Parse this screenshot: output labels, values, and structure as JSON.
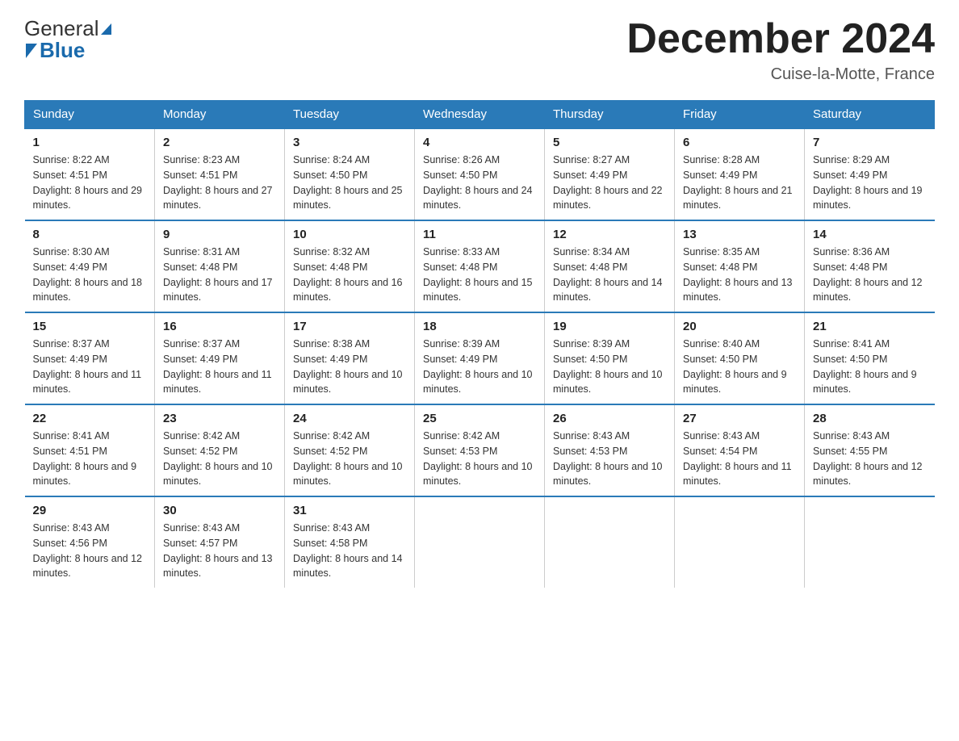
{
  "header": {
    "logo_general": "General",
    "logo_blue": "Blue",
    "month_title": "December 2024",
    "location": "Cuise-la-Motte, France"
  },
  "days_of_week": [
    "Sunday",
    "Monday",
    "Tuesday",
    "Wednesday",
    "Thursday",
    "Friday",
    "Saturday"
  ],
  "weeks": [
    [
      {
        "day": "1",
        "sunrise": "8:22 AM",
        "sunset": "4:51 PM",
        "daylight": "8 hours and 29 minutes."
      },
      {
        "day": "2",
        "sunrise": "8:23 AM",
        "sunset": "4:51 PM",
        "daylight": "8 hours and 27 minutes."
      },
      {
        "day": "3",
        "sunrise": "8:24 AM",
        "sunset": "4:50 PM",
        "daylight": "8 hours and 25 minutes."
      },
      {
        "day": "4",
        "sunrise": "8:26 AM",
        "sunset": "4:50 PM",
        "daylight": "8 hours and 24 minutes."
      },
      {
        "day": "5",
        "sunrise": "8:27 AM",
        "sunset": "4:49 PM",
        "daylight": "8 hours and 22 minutes."
      },
      {
        "day": "6",
        "sunrise": "8:28 AM",
        "sunset": "4:49 PM",
        "daylight": "8 hours and 21 minutes."
      },
      {
        "day": "7",
        "sunrise": "8:29 AM",
        "sunset": "4:49 PM",
        "daylight": "8 hours and 19 minutes."
      }
    ],
    [
      {
        "day": "8",
        "sunrise": "8:30 AM",
        "sunset": "4:49 PM",
        "daylight": "8 hours and 18 minutes."
      },
      {
        "day": "9",
        "sunrise": "8:31 AM",
        "sunset": "4:48 PM",
        "daylight": "8 hours and 17 minutes."
      },
      {
        "day": "10",
        "sunrise": "8:32 AM",
        "sunset": "4:48 PM",
        "daylight": "8 hours and 16 minutes."
      },
      {
        "day": "11",
        "sunrise": "8:33 AM",
        "sunset": "4:48 PM",
        "daylight": "8 hours and 15 minutes."
      },
      {
        "day": "12",
        "sunrise": "8:34 AM",
        "sunset": "4:48 PM",
        "daylight": "8 hours and 14 minutes."
      },
      {
        "day": "13",
        "sunrise": "8:35 AM",
        "sunset": "4:48 PM",
        "daylight": "8 hours and 13 minutes."
      },
      {
        "day": "14",
        "sunrise": "8:36 AM",
        "sunset": "4:48 PM",
        "daylight": "8 hours and 12 minutes."
      }
    ],
    [
      {
        "day": "15",
        "sunrise": "8:37 AM",
        "sunset": "4:49 PM",
        "daylight": "8 hours and 11 minutes."
      },
      {
        "day": "16",
        "sunrise": "8:37 AM",
        "sunset": "4:49 PM",
        "daylight": "8 hours and 11 minutes."
      },
      {
        "day": "17",
        "sunrise": "8:38 AM",
        "sunset": "4:49 PM",
        "daylight": "8 hours and 10 minutes."
      },
      {
        "day": "18",
        "sunrise": "8:39 AM",
        "sunset": "4:49 PM",
        "daylight": "8 hours and 10 minutes."
      },
      {
        "day": "19",
        "sunrise": "8:39 AM",
        "sunset": "4:50 PM",
        "daylight": "8 hours and 10 minutes."
      },
      {
        "day": "20",
        "sunrise": "8:40 AM",
        "sunset": "4:50 PM",
        "daylight": "8 hours and 9 minutes."
      },
      {
        "day": "21",
        "sunrise": "8:41 AM",
        "sunset": "4:50 PM",
        "daylight": "8 hours and 9 minutes."
      }
    ],
    [
      {
        "day": "22",
        "sunrise": "8:41 AM",
        "sunset": "4:51 PM",
        "daylight": "8 hours and 9 minutes."
      },
      {
        "day": "23",
        "sunrise": "8:42 AM",
        "sunset": "4:52 PM",
        "daylight": "8 hours and 10 minutes."
      },
      {
        "day": "24",
        "sunrise": "8:42 AM",
        "sunset": "4:52 PM",
        "daylight": "8 hours and 10 minutes."
      },
      {
        "day": "25",
        "sunrise": "8:42 AM",
        "sunset": "4:53 PM",
        "daylight": "8 hours and 10 minutes."
      },
      {
        "day": "26",
        "sunrise": "8:43 AM",
        "sunset": "4:53 PM",
        "daylight": "8 hours and 10 minutes."
      },
      {
        "day": "27",
        "sunrise": "8:43 AM",
        "sunset": "4:54 PM",
        "daylight": "8 hours and 11 minutes."
      },
      {
        "day": "28",
        "sunrise": "8:43 AM",
        "sunset": "4:55 PM",
        "daylight": "8 hours and 12 minutes."
      }
    ],
    [
      {
        "day": "29",
        "sunrise": "8:43 AM",
        "sunset": "4:56 PM",
        "daylight": "8 hours and 12 minutes."
      },
      {
        "day": "30",
        "sunrise": "8:43 AM",
        "sunset": "4:57 PM",
        "daylight": "8 hours and 13 minutes."
      },
      {
        "day": "31",
        "sunrise": "8:43 AM",
        "sunset": "4:58 PM",
        "daylight": "8 hours and 14 minutes."
      },
      null,
      null,
      null,
      null
    ]
  ],
  "labels": {
    "sunrise_prefix": "Sunrise: ",
    "sunset_prefix": "Sunset: ",
    "daylight_prefix": "Daylight: "
  }
}
